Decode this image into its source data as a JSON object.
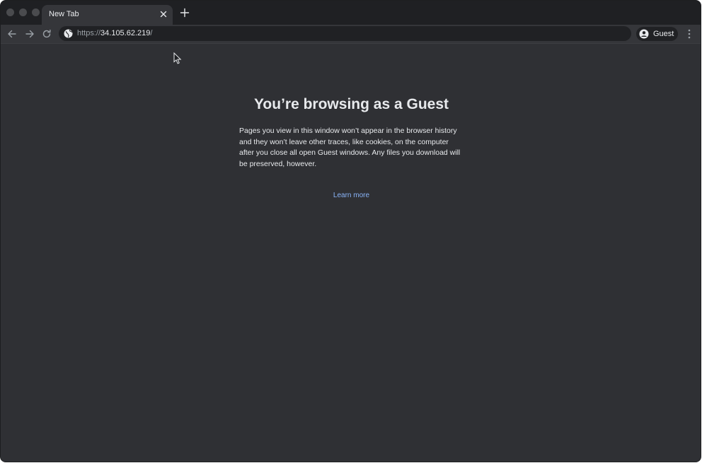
{
  "tab": {
    "title": "New Tab"
  },
  "toolbar": {
    "url_scheme": "https://",
    "url_host": "34.105.62.219",
    "url_path": "/",
    "profile_label": "Guest"
  },
  "page": {
    "heading": "You’re browsing as a Guest",
    "body": "Pages you view in this window won’t appear in the browser history and they won’t leave other traces, like cookies, on the computer after you close all open Guest windows. Any files you download will be preserved, however.",
    "learn_more": "Learn more"
  },
  "colors": {
    "background": "#2f3034",
    "tabstrip": "#1f2023",
    "toolbar": "#35363a",
    "omnibox": "#202124",
    "text": "#e8eaed",
    "link": "#8ab4f8"
  },
  "icons": [
    "close-icon",
    "plus-icon",
    "back-arrow-icon",
    "forward-arrow-icon",
    "reload-icon",
    "globe-icon",
    "account-circle-icon",
    "more-vert-icon",
    "cursor-icon"
  ]
}
